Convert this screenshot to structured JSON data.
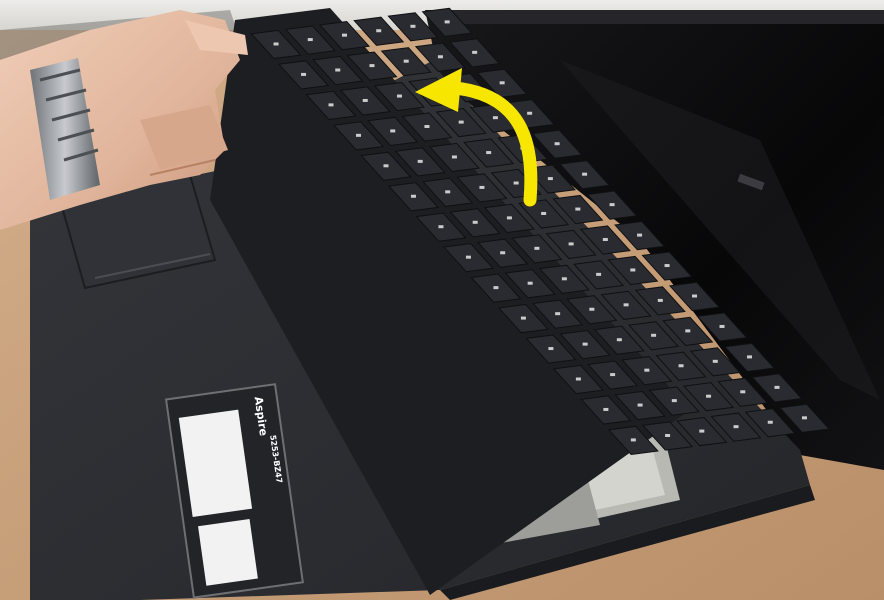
{
  "photo": {
    "subject": "laptop keyboard removal",
    "annotation": {
      "shape": "curved arrow",
      "color": "#f7e600",
      "direction": "up-left"
    },
    "colors": {
      "table_wood": "#c9a27c",
      "laptop_body": "#2b2d31",
      "keyboard": "#1f2024",
      "keycap": "#2a2b30",
      "key_legend": "#e8e8ea",
      "screen": "#0b0b0d",
      "skin": "#e3b9a1",
      "watch": "#9a9ea4",
      "sticker_white": "#f2f2f2"
    },
    "sticker_brand": "Aspire",
    "sticker_model": "5253-BZ47"
  }
}
